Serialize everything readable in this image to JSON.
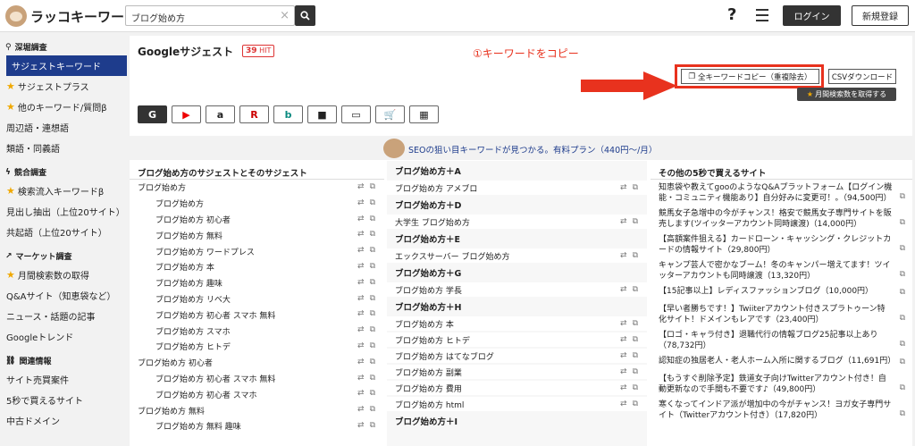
{
  "header": {
    "logo": "ラッコキーワード",
    "search_value": "ブログ始め方",
    "login": "ログイン",
    "register": "新規登録",
    "help": "?"
  },
  "sidebar": {
    "sections": [
      {
        "label": "深堀調査",
        "items": [
          {
            "label": "サジェストキーワード",
            "star": false,
            "active": true
          },
          {
            "label": "サジェストプラス",
            "star": true
          },
          {
            "label": "他のキーワード/質問β",
            "star": true
          },
          {
            "label": "周辺語・連想語",
            "star": false
          },
          {
            "label": "類語・同義語",
            "star": false
          }
        ]
      },
      {
        "label": "競合調査",
        "items": [
          {
            "label": "検索流入キーワードβ",
            "star": true
          },
          {
            "label": "見出し抽出（上位20サイト）",
            "star": false
          },
          {
            "label": "共起語（上位20サイト）",
            "star": false
          }
        ]
      },
      {
        "label": "マーケット調査",
        "items": [
          {
            "label": "月間検索数の取得",
            "star": true
          },
          {
            "label": "Q&Aサイト（知恵袋など）",
            "star": false
          },
          {
            "label": "ニュース・話題の記事",
            "star": false
          },
          {
            "label": "Googleトレンド",
            "star": false
          }
        ]
      },
      {
        "label": "関連情報",
        "items": [
          {
            "label": "サイト売買案件",
            "star": false
          },
          {
            "label": "5秒で買えるサイト",
            "star": false
          },
          {
            "label": "中古ドメイン",
            "star": false
          }
        ]
      }
    ]
  },
  "main": {
    "title": "Googleサジェスト",
    "hit_count": "39",
    "hit_label": "HIT",
    "annotation": "①キーワードをコピー",
    "copy_button": "全キーワードコピー（重複除去）",
    "csv_button": "CSVダウンロード",
    "volume_button": "月間検索数を取得する",
    "engines": [
      {
        "icon": "google-icon",
        "glyph": "G",
        "active": true
      },
      {
        "icon": "youtube-icon",
        "glyph": "▶"
      },
      {
        "icon": "amazon-icon",
        "glyph": "a"
      },
      {
        "icon": "rakuten-icon",
        "glyph": "R"
      },
      {
        "icon": "bing-icon",
        "glyph": "b"
      },
      {
        "icon": "video-icon",
        "glyph": "■"
      },
      {
        "icon": "image-icon",
        "glyph": "▭"
      },
      {
        "icon": "cart-icon",
        "glyph": "🛒"
      },
      {
        "icon": "grid-icon",
        "glyph": "▦"
      }
    ],
    "banner": "SEOの狙い目キーワードが見つかる。有料プラン（440円〜/月）"
  },
  "col1": {
    "header": "ブログ始め方のサジェストとそのサジェスト",
    "rows": [
      {
        "text": "ブログ始め方",
        "sub": false
      },
      {
        "text": "ブログ始め方",
        "sub": true
      },
      {
        "text": "ブログ始め方 初心者",
        "sub": true
      },
      {
        "text": "ブログ始め方 無料",
        "sub": true
      },
      {
        "text": "ブログ始め方 ワードプレス",
        "sub": true
      },
      {
        "text": "ブログ始め方 本",
        "sub": true
      },
      {
        "text": "ブログ始め方 趣味",
        "sub": true
      },
      {
        "text": "ブログ始め方 リベ大",
        "sub": true
      },
      {
        "text": "ブログ始め方 初心者 スマホ 無料",
        "sub": true
      },
      {
        "text": "ブログ始め方 スマホ",
        "sub": true
      },
      {
        "text": "ブログ始め方 ヒトデ",
        "sub": true
      },
      {
        "text": "ブログ始め方 初心者",
        "sub": false
      },
      {
        "text": "ブログ始め方 初心者 スマホ 無料",
        "sub": true
      },
      {
        "text": "ブログ始め方 初心者 スマホ",
        "sub": true
      },
      {
        "text": "ブログ始め方 無料",
        "sub": false
      },
      {
        "text": "ブログ始め方 無料 趣味",
        "sub": true
      }
    ]
  },
  "col2": {
    "rows": [
      {
        "text": "ブログ始め方＋A",
        "grp": true
      },
      {
        "text": "ブログ始め方 アメブロ",
        "grp": false
      },
      {
        "text": "ブログ始め方＋D",
        "grp": true
      },
      {
        "text": "大学生 ブログ始め方",
        "grp": false
      },
      {
        "text": "ブログ始め方＋E",
        "grp": true
      },
      {
        "text": "エックスサーバー ブログ始め方",
        "grp": false
      },
      {
        "text": "ブログ始め方＋G",
        "grp": true
      },
      {
        "text": "ブログ始め方 学長",
        "grp": false
      },
      {
        "text": "ブログ始め方＋H",
        "grp": true
      },
      {
        "text": "ブログ始め方 本",
        "grp": false
      },
      {
        "text": "ブログ始め方 ヒトデ",
        "grp": false
      },
      {
        "text": "ブログ始め方 はてなブログ",
        "grp": false
      },
      {
        "text": "ブログ始め方 副業",
        "grp": false
      },
      {
        "text": "ブログ始め方 費用",
        "grp": false
      },
      {
        "text": "ブログ始め方 html",
        "grp": false
      },
      {
        "text": "ブログ始め方＋I",
        "grp": true
      }
    ]
  },
  "col3": {
    "header": "その他の5秒で買えるサイト",
    "items": [
      "知恵袋や教えてgooのようなQ&Aプラットフォーム【ログイン機能・コミュニティ機能あり】自分好みに変更可！。（94,500円）",
      "競馬女子急増中の今がチャンス！格安で競馬女子専門サイトを販売します(ツイッターアカウント同時譲渡)（14,000円）",
      "【高額案件狙える】カードローン・キャッシング・クレジットカードの情報サイト（29,800円）",
      "キャンプ芸人で密かなブーム！冬のキャンパー増えてます！ツイッターアカウントも同時譲渡（13,320円）",
      "【15記事以上】レディスファッションブログ（10,000円）",
      "【早い者勝ちです！】Twiiterアカウント付きスプラトゥーン特化サイト！ドメインもレアです（23,400円）",
      "【ロゴ・キャラ付き】退職代行の情報ブログ25記事以上あり（78,732円）",
      "認知症の独居老人・老人ホーム入所に関するブログ（11,691円）",
      "【もうすぐ削除予定】鉄道女子向けTwitterアカウント付き！自動更新なので手間も不要です♪（49,800円）",
      "寒くなってインドア派が増加中の今がチャンス！ヨガ女子専門サイト（Twitterアカウント付き）（17,820円）"
    ]
  }
}
